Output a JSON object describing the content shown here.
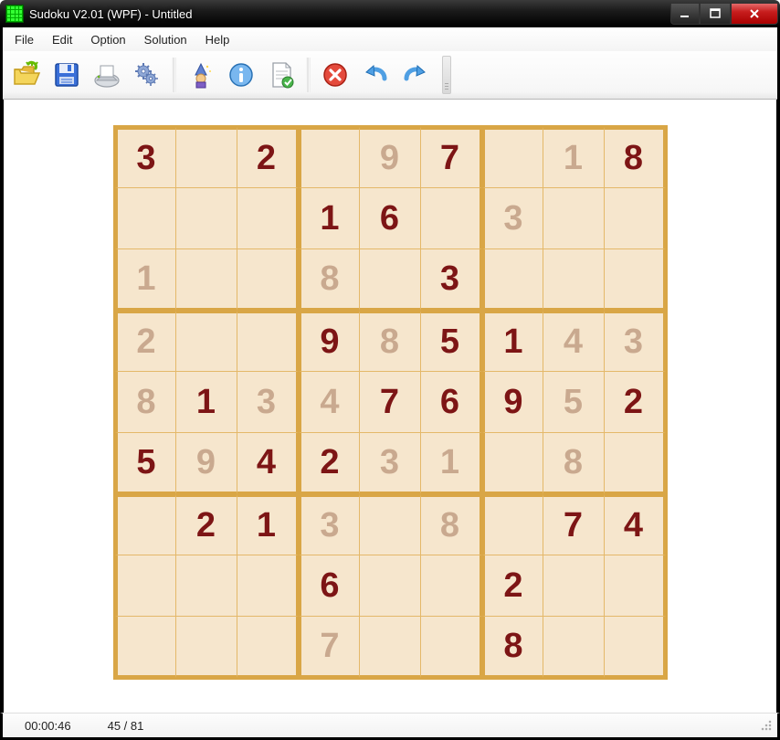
{
  "window": {
    "title": "Sudoku V2.01 (WPF) - Untitled"
  },
  "menu": {
    "items": [
      "File",
      "Edit",
      "Option",
      "Solution",
      "Help"
    ]
  },
  "toolbar": {
    "buttons": [
      {
        "name": "open-icon"
      },
      {
        "name": "save-icon"
      },
      {
        "name": "print-icon"
      },
      {
        "name": "settings-icon"
      },
      {
        "sep": true
      },
      {
        "name": "wizard-icon"
      },
      {
        "name": "info-icon"
      },
      {
        "name": "check-doc-icon"
      },
      {
        "sep": true
      },
      {
        "name": "delete-icon"
      },
      {
        "name": "undo-icon"
      },
      {
        "name": "redo-icon"
      }
    ]
  },
  "status": {
    "time": "00:00:46",
    "progress": "45 / 81"
  },
  "sudoku": {
    "grid": [
      [
        {
          "v": "3",
          "t": "g"
        },
        {
          "v": ""
        },
        {
          "v": "2",
          "t": "g"
        },
        {
          "v": ""
        },
        {
          "v": "9",
          "t": "s"
        },
        {
          "v": "7",
          "t": "g"
        },
        {
          "v": ""
        },
        {
          "v": "1",
          "t": "s"
        },
        {
          "v": "8",
          "t": "g"
        }
      ],
      [
        {
          "v": ""
        },
        {
          "v": ""
        },
        {
          "v": ""
        },
        {
          "v": "1",
          "t": "g"
        },
        {
          "v": "6",
          "t": "g"
        },
        {
          "v": ""
        },
        {
          "v": "3",
          "t": "s"
        },
        {
          "v": ""
        },
        {
          "v": ""
        }
      ],
      [
        {
          "v": "1",
          "t": "s"
        },
        {
          "v": ""
        },
        {
          "v": ""
        },
        {
          "v": "8",
          "t": "s"
        },
        {
          "v": ""
        },
        {
          "v": "3",
          "t": "g"
        },
        {
          "v": ""
        },
        {
          "v": ""
        },
        {
          "v": ""
        }
      ],
      [
        {
          "v": "2",
          "t": "s"
        },
        {
          "v": ""
        },
        {
          "v": ""
        },
        {
          "v": "9",
          "t": "g"
        },
        {
          "v": "8",
          "t": "s"
        },
        {
          "v": "5",
          "t": "g"
        },
        {
          "v": "1",
          "t": "g"
        },
        {
          "v": "4",
          "t": "s"
        },
        {
          "v": "3",
          "t": "s"
        }
      ],
      [
        {
          "v": "8",
          "t": "s"
        },
        {
          "v": "1",
          "t": "g"
        },
        {
          "v": "3",
          "t": "s"
        },
        {
          "v": "4",
          "t": "s"
        },
        {
          "v": "7",
          "t": "g"
        },
        {
          "v": "6",
          "t": "g"
        },
        {
          "v": "9",
          "t": "g"
        },
        {
          "v": "5",
          "t": "s"
        },
        {
          "v": "2",
          "t": "g"
        }
      ],
      [
        {
          "v": "5",
          "t": "g"
        },
        {
          "v": "9",
          "t": "s"
        },
        {
          "v": "4",
          "t": "g"
        },
        {
          "v": "2",
          "t": "g"
        },
        {
          "v": "3",
          "t": "s"
        },
        {
          "v": "1",
          "t": "s"
        },
        {
          "v": ""
        },
        {
          "v": "8",
          "t": "s"
        },
        {
          "v": ""
        }
      ],
      [
        {
          "v": ""
        },
        {
          "v": "2",
          "t": "g"
        },
        {
          "v": "1",
          "t": "g"
        },
        {
          "v": "3",
          "t": "s"
        },
        {
          "v": ""
        },
        {
          "v": "8",
          "t": "s"
        },
        {
          "v": ""
        },
        {
          "v": "7",
          "t": "g"
        },
        {
          "v": "4",
          "t": "g"
        }
      ],
      [
        {
          "v": ""
        },
        {
          "v": ""
        },
        {
          "v": ""
        },
        {
          "v": "6",
          "t": "g"
        },
        {
          "v": ""
        },
        {
          "v": ""
        },
        {
          "v": "2",
          "t": "g"
        },
        {
          "v": ""
        },
        {
          "v": ""
        }
      ],
      [
        {
          "v": ""
        },
        {
          "v": ""
        },
        {
          "v": ""
        },
        {
          "v": "7",
          "t": "s"
        },
        {
          "v": ""
        },
        {
          "v": ""
        },
        {
          "v": "8",
          "t": "g"
        },
        {
          "v": ""
        },
        {
          "v": ""
        }
      ]
    ]
  }
}
